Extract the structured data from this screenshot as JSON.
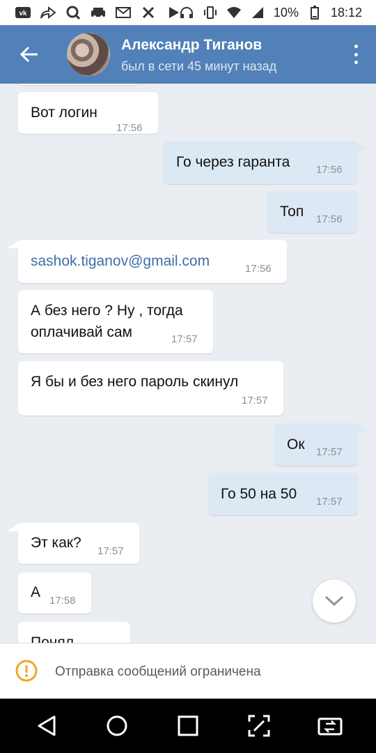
{
  "status_bar": {
    "battery": "10%",
    "time": "18:12",
    "left_icons": [
      "vk-icon",
      "share-icon",
      "search-icon",
      "car-icon",
      "gmail-icon",
      "tools-icon",
      "play-icon"
    ],
    "right_icons": [
      "headphones-icon",
      "vibrate-icon",
      "wifi-icon",
      "signal-icon",
      "battery-icon"
    ]
  },
  "header": {
    "name": "Александр Тиганов",
    "status": "был в сети 45 минут назад"
  },
  "messages": [
    {
      "dir": "in",
      "text": "Вот логин",
      "time": "17:56"
    },
    {
      "dir": "out",
      "text": "Го через гаранта",
      "time": "17:56"
    },
    {
      "dir": "out",
      "text": "Топ",
      "time": "17:56"
    },
    {
      "dir": "in",
      "text": "sashok.tiganov@gmail.com",
      "time": "17:56",
      "link": true
    },
    {
      "dir": "in",
      "text_line1": "А без него ? Ну , тогда",
      "text_line2": "оплачивай сам",
      "time": "17:57"
    },
    {
      "dir": "in",
      "text": "Я бы и без него пароль скинул",
      "time": "17:57"
    },
    {
      "dir": "out",
      "text": "Ок",
      "time": "17:57"
    },
    {
      "dir": "out",
      "text": "Го 50 на 50",
      "time": "17:57"
    },
    {
      "dir": "in",
      "text": "Эт как?",
      "time": "17:57"
    },
    {
      "dir": "in",
      "text": "А",
      "time": "17:58"
    },
    {
      "dir": "in",
      "text": "Понял",
      "time": ""
    }
  ],
  "banner": {
    "text": "Отправка сообщений ограничена"
  },
  "colors": {
    "header_bg": "#5181b8",
    "chat_bg": "#eaeef3",
    "outgoing_bubble": "#dde8f5",
    "incoming_bubble": "#ffffff",
    "warning": "#f2a527"
  }
}
